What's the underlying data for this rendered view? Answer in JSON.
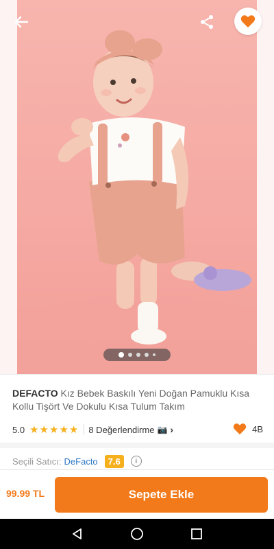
{
  "product": {
    "brand": "DEFACTO",
    "title": "Kız Bebek Baskılı Yeni Doğan Pamuklu Kısa Kollu Tişört Ve Dokulu Kısa Tulum Takım",
    "rating": "5.0",
    "star_count": 5,
    "reviews_label": "8 Değerlendirme",
    "favorites_count": "4B"
  },
  "gallery": {
    "image_count": 5,
    "active_index": 0
  },
  "seller": {
    "label": "Seçili Satıcı:",
    "name": "DeFacto",
    "score": "7.6"
  },
  "bottom_bar": {
    "price": "99.99 TL",
    "add_to_cart_label": "Sepete Ekle"
  },
  "colors": {
    "accent": "#f27a1a",
    "star": "#f6b01e",
    "seller_link": "#2f78c5"
  },
  "icons": {
    "back": "arrow-left-icon",
    "share": "share-icon",
    "favorite": "heart-icon",
    "camera": "camera-icon",
    "info": "info-icon"
  }
}
